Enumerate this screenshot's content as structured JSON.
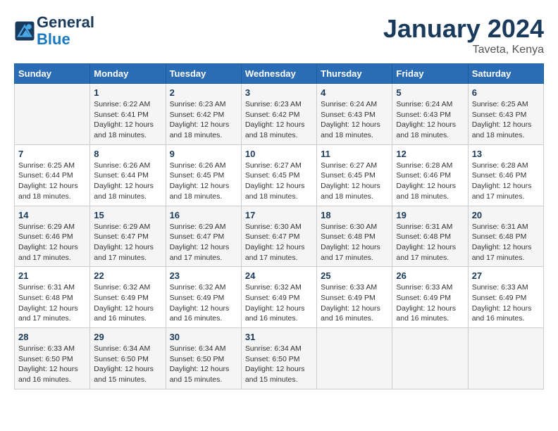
{
  "header": {
    "logo_line1": "General",
    "logo_line2": "Blue",
    "month": "January 2024",
    "location": "Taveta, Kenya"
  },
  "days_of_week": [
    "Sunday",
    "Monday",
    "Tuesday",
    "Wednesday",
    "Thursday",
    "Friday",
    "Saturday"
  ],
  "weeks": [
    [
      {
        "day": "",
        "sunrise": "",
        "sunset": "",
        "daylight": ""
      },
      {
        "day": "1",
        "sunrise": "Sunrise: 6:22 AM",
        "sunset": "Sunset: 6:41 PM",
        "daylight": "Daylight: 12 hours and 18 minutes."
      },
      {
        "day": "2",
        "sunrise": "Sunrise: 6:23 AM",
        "sunset": "Sunset: 6:42 PM",
        "daylight": "Daylight: 12 hours and 18 minutes."
      },
      {
        "day": "3",
        "sunrise": "Sunrise: 6:23 AM",
        "sunset": "Sunset: 6:42 PM",
        "daylight": "Daylight: 12 hours and 18 minutes."
      },
      {
        "day": "4",
        "sunrise": "Sunrise: 6:24 AM",
        "sunset": "Sunset: 6:43 PM",
        "daylight": "Daylight: 12 hours and 18 minutes."
      },
      {
        "day": "5",
        "sunrise": "Sunrise: 6:24 AM",
        "sunset": "Sunset: 6:43 PM",
        "daylight": "Daylight: 12 hours and 18 minutes."
      },
      {
        "day": "6",
        "sunrise": "Sunrise: 6:25 AM",
        "sunset": "Sunset: 6:43 PM",
        "daylight": "Daylight: 12 hours and 18 minutes."
      }
    ],
    [
      {
        "day": "7",
        "sunrise": "Sunrise: 6:25 AM",
        "sunset": "Sunset: 6:44 PM",
        "daylight": "Daylight: 12 hours and 18 minutes."
      },
      {
        "day": "8",
        "sunrise": "Sunrise: 6:26 AM",
        "sunset": "Sunset: 6:44 PM",
        "daylight": "Daylight: 12 hours and 18 minutes."
      },
      {
        "day": "9",
        "sunrise": "Sunrise: 6:26 AM",
        "sunset": "Sunset: 6:45 PM",
        "daylight": "Daylight: 12 hours and 18 minutes."
      },
      {
        "day": "10",
        "sunrise": "Sunrise: 6:27 AM",
        "sunset": "Sunset: 6:45 PM",
        "daylight": "Daylight: 12 hours and 18 minutes."
      },
      {
        "day": "11",
        "sunrise": "Sunrise: 6:27 AM",
        "sunset": "Sunset: 6:45 PM",
        "daylight": "Daylight: 12 hours and 18 minutes."
      },
      {
        "day": "12",
        "sunrise": "Sunrise: 6:28 AM",
        "sunset": "Sunset: 6:46 PM",
        "daylight": "Daylight: 12 hours and 18 minutes."
      },
      {
        "day": "13",
        "sunrise": "Sunrise: 6:28 AM",
        "sunset": "Sunset: 6:46 PM",
        "daylight": "Daylight: 12 hours and 17 minutes."
      }
    ],
    [
      {
        "day": "14",
        "sunrise": "Sunrise: 6:29 AM",
        "sunset": "Sunset: 6:46 PM",
        "daylight": "Daylight: 12 hours and 17 minutes."
      },
      {
        "day": "15",
        "sunrise": "Sunrise: 6:29 AM",
        "sunset": "Sunset: 6:47 PM",
        "daylight": "Daylight: 12 hours and 17 minutes."
      },
      {
        "day": "16",
        "sunrise": "Sunrise: 6:29 AM",
        "sunset": "Sunset: 6:47 PM",
        "daylight": "Daylight: 12 hours and 17 minutes."
      },
      {
        "day": "17",
        "sunrise": "Sunrise: 6:30 AM",
        "sunset": "Sunset: 6:47 PM",
        "daylight": "Daylight: 12 hours and 17 minutes."
      },
      {
        "day": "18",
        "sunrise": "Sunrise: 6:30 AM",
        "sunset": "Sunset: 6:48 PM",
        "daylight": "Daylight: 12 hours and 17 minutes."
      },
      {
        "day": "19",
        "sunrise": "Sunrise: 6:31 AM",
        "sunset": "Sunset: 6:48 PM",
        "daylight": "Daylight: 12 hours and 17 minutes."
      },
      {
        "day": "20",
        "sunrise": "Sunrise: 6:31 AM",
        "sunset": "Sunset: 6:48 PM",
        "daylight": "Daylight: 12 hours and 17 minutes."
      }
    ],
    [
      {
        "day": "21",
        "sunrise": "Sunrise: 6:31 AM",
        "sunset": "Sunset: 6:48 PM",
        "daylight": "Daylight: 12 hours and 17 minutes."
      },
      {
        "day": "22",
        "sunrise": "Sunrise: 6:32 AM",
        "sunset": "Sunset: 6:49 PM",
        "daylight": "Daylight: 12 hours and 16 minutes."
      },
      {
        "day": "23",
        "sunrise": "Sunrise: 6:32 AM",
        "sunset": "Sunset: 6:49 PM",
        "daylight": "Daylight: 12 hours and 16 minutes."
      },
      {
        "day": "24",
        "sunrise": "Sunrise: 6:32 AM",
        "sunset": "Sunset: 6:49 PM",
        "daylight": "Daylight: 12 hours and 16 minutes."
      },
      {
        "day": "25",
        "sunrise": "Sunrise: 6:33 AM",
        "sunset": "Sunset: 6:49 PM",
        "daylight": "Daylight: 12 hours and 16 minutes."
      },
      {
        "day": "26",
        "sunrise": "Sunrise: 6:33 AM",
        "sunset": "Sunset: 6:49 PM",
        "daylight": "Daylight: 12 hours and 16 minutes."
      },
      {
        "day": "27",
        "sunrise": "Sunrise: 6:33 AM",
        "sunset": "Sunset: 6:49 PM",
        "daylight": "Daylight: 12 hours and 16 minutes."
      }
    ],
    [
      {
        "day": "28",
        "sunrise": "Sunrise: 6:33 AM",
        "sunset": "Sunset: 6:50 PM",
        "daylight": "Daylight: 12 hours and 16 minutes."
      },
      {
        "day": "29",
        "sunrise": "Sunrise: 6:34 AM",
        "sunset": "Sunset: 6:50 PM",
        "daylight": "Daylight: 12 hours and 15 minutes."
      },
      {
        "day": "30",
        "sunrise": "Sunrise: 6:34 AM",
        "sunset": "Sunset: 6:50 PM",
        "daylight": "Daylight: 12 hours and 15 minutes."
      },
      {
        "day": "31",
        "sunrise": "Sunrise: 6:34 AM",
        "sunset": "Sunset: 6:50 PM",
        "daylight": "Daylight: 12 hours and 15 minutes."
      },
      {
        "day": "",
        "sunrise": "",
        "sunset": "",
        "daylight": ""
      },
      {
        "day": "",
        "sunrise": "",
        "sunset": "",
        "daylight": ""
      },
      {
        "day": "",
        "sunrise": "",
        "sunset": "",
        "daylight": ""
      }
    ]
  ]
}
